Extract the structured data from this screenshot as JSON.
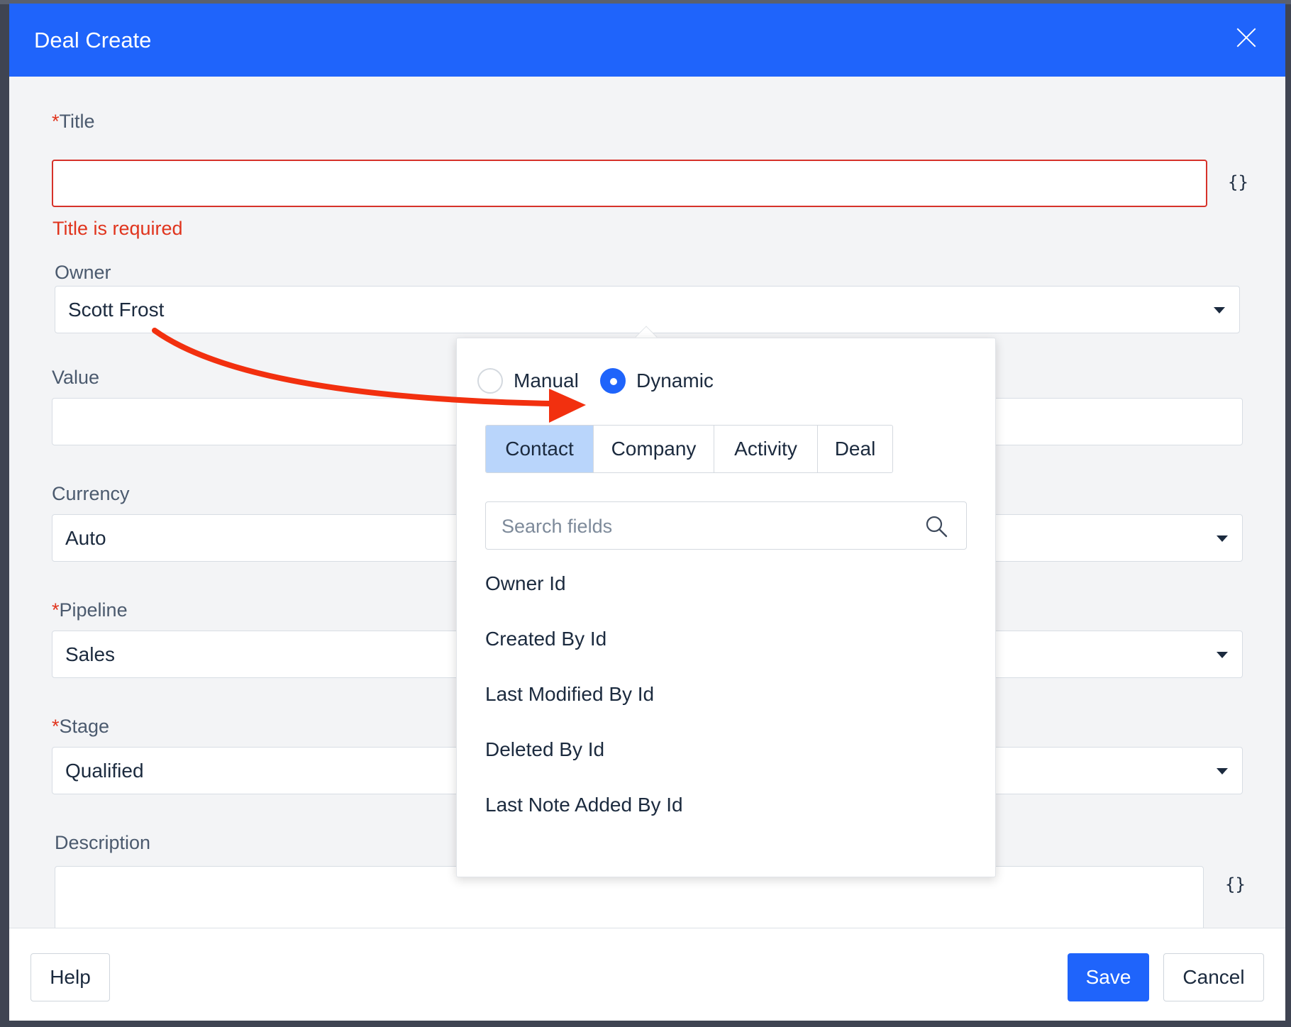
{
  "modal": {
    "title": "Deal Create"
  },
  "form": {
    "title_label": "Title",
    "title_error": "Title is required",
    "owner_label": "Owner",
    "owner_value": "Scott Frost",
    "value_label": "Value",
    "currency_label": "Currency",
    "currency_value": "Auto",
    "pipeline_label": "Pipeline",
    "pipeline_value": "Sales",
    "stage_label": "Stage",
    "stage_value": "Qualified",
    "description_label": "Description",
    "required_mark": "*",
    "braces": "{}"
  },
  "popover": {
    "mode_options": [
      "Manual",
      "Dynamic"
    ],
    "selected_mode": "Dynamic",
    "tabs": [
      "Contact",
      "Company",
      "Activity",
      "Deal"
    ],
    "active_tab": "Contact",
    "search_placeholder": "Search fields",
    "fields": [
      "Owner Id",
      "Created By Id",
      "Last Modified By Id",
      "Deleted By Id",
      "Last Note Added By Id"
    ]
  },
  "footer": {
    "help_label": "Help",
    "save_label": "Save",
    "cancel_label": "Cancel"
  },
  "colors": {
    "accent": "#1f64fb",
    "error": "#e0341d",
    "active_tab": "#b9d5fb",
    "annotation_arrow": "#f2300f"
  },
  "icons": [
    "close-icon",
    "braces-icon",
    "chevron-down-icon",
    "search-icon",
    "annotation-arrow"
  ]
}
